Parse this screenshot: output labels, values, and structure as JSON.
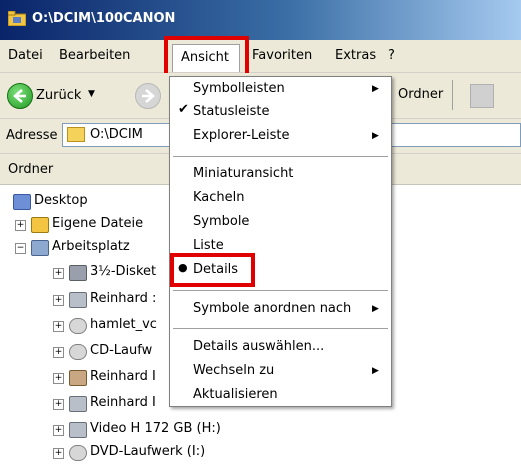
{
  "window": {
    "title": "O:\\DCIM\\100CANON"
  },
  "menubar": {
    "items": [
      "Datei",
      "Bearbeiten",
      "Ansicht",
      "Favoriten",
      "Extras",
      "?"
    ]
  },
  "toolbar": {
    "back_label": "Zurück",
    "folders_label": "Ordner"
  },
  "address": {
    "label": "Adresse",
    "value": "O:\\DCIM"
  },
  "folder_pane": {
    "title": "Ordner",
    "tree": [
      {
        "label": "Desktop",
        "icon": "desktop-icon"
      },
      {
        "label": "Eigene Dateie",
        "icon": "folder-icon",
        "expander": "+"
      },
      {
        "label": "Arbeitsplatz",
        "icon": "computer-icon",
        "expander": "−"
      },
      {
        "label": "3½-Disket",
        "icon": "floppy-icon",
        "expander": "+"
      },
      {
        "label": "Reinhard :",
        "icon": "drive-icon",
        "expander": "+"
      },
      {
        "label": "hamlet_vc",
        "icon": "cd-icon",
        "expander": "+"
      },
      {
        "label": "CD-Laufw",
        "icon": "cd-icon",
        "expander": "+"
      },
      {
        "label": "Reinhard I",
        "icon": "drive-icon",
        "expander": "+"
      },
      {
        "label": "Reinhard I",
        "icon": "drive-icon",
        "expander": "+"
      },
      {
        "label": "Video H 172 GB (H:)",
        "icon": "drive-icon",
        "expander": "+"
      },
      {
        "label": "DVD-Laufwerk (I:)",
        "icon": "cd-icon",
        "expander": "+"
      }
    ]
  },
  "view_menu": {
    "items": [
      {
        "label": "Symbolleisten",
        "submenu": true
      },
      {
        "label": "Statusleiste",
        "checked": true
      },
      {
        "label": "Explorer-Leiste",
        "submenu": true
      },
      {
        "label": "Miniaturansicht"
      },
      {
        "label": "Kacheln"
      },
      {
        "label": "Symbole"
      },
      {
        "label": "Liste"
      },
      {
        "label": "Details",
        "selected": true
      },
      {
        "label": "Symbole anordnen nach",
        "submenu": true
      },
      {
        "label": "Details auswählen..."
      },
      {
        "label": "Wechseln zu",
        "submenu": true
      },
      {
        "label": "Aktualisieren"
      }
    ]
  },
  "colors": {
    "title_start": "#0a246a",
    "title_end": "#a6caf0",
    "highlight_red": "#e00000",
    "menu_bg": "#ece9d8"
  }
}
